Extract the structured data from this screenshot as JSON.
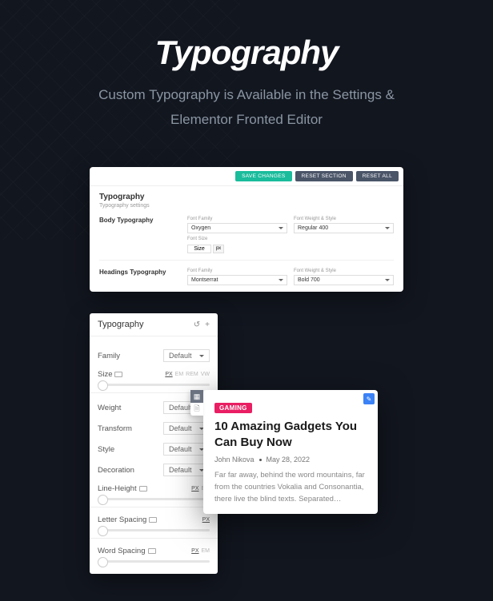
{
  "hero": {
    "title": "Typography",
    "subtitle_line1": "Custom Typography is Available in the Settings &",
    "subtitle_line2": "Elementor Fronted Editor"
  },
  "settings_panel": {
    "buttons": {
      "save": "SAVE CHANGES",
      "reset_section": "RESET SECTION",
      "reset_all": "RESET ALL"
    },
    "heading": "Typography",
    "subheading": "Typography settings",
    "body_typo": {
      "label": "Body Typography",
      "font_family": {
        "label": "Font Family",
        "value": "Oxygen"
      },
      "font_weight": {
        "label": "Font Weight & Style",
        "value": "Regular 400"
      },
      "font_size": {
        "label": "Font Size",
        "placeholder": "Size",
        "unit": "px"
      }
    },
    "headings_typo": {
      "label": "Headings Typography",
      "font_family": {
        "label": "Font Family",
        "value": "Montserrat"
      },
      "font_weight": {
        "label": "Font Weight & Style",
        "value": "Bold 700"
      }
    }
  },
  "elementor_panel": {
    "title": "Typography",
    "default_value": "Default",
    "rows": {
      "family": "Family",
      "size": "Size",
      "weight": "Weight",
      "transform": "Transform",
      "style": "Style",
      "decoration": "Decoration",
      "line_height": "Line-Height",
      "letter_spacing": "Letter Spacing",
      "word_spacing": "Word Spacing"
    },
    "units": {
      "px": "PX",
      "em": "EM",
      "rem": "REM",
      "vw": "VW"
    }
  },
  "preview_card": {
    "badge": "GAMING",
    "title": "10 Amazing Gadgets You Can Buy Now",
    "author": "John Nikova",
    "date": "May 28, 2022",
    "excerpt": "Far far away, behind the word mountains, far from the countries Vokalia and Consonantia, there live the blind texts. Separated…"
  }
}
